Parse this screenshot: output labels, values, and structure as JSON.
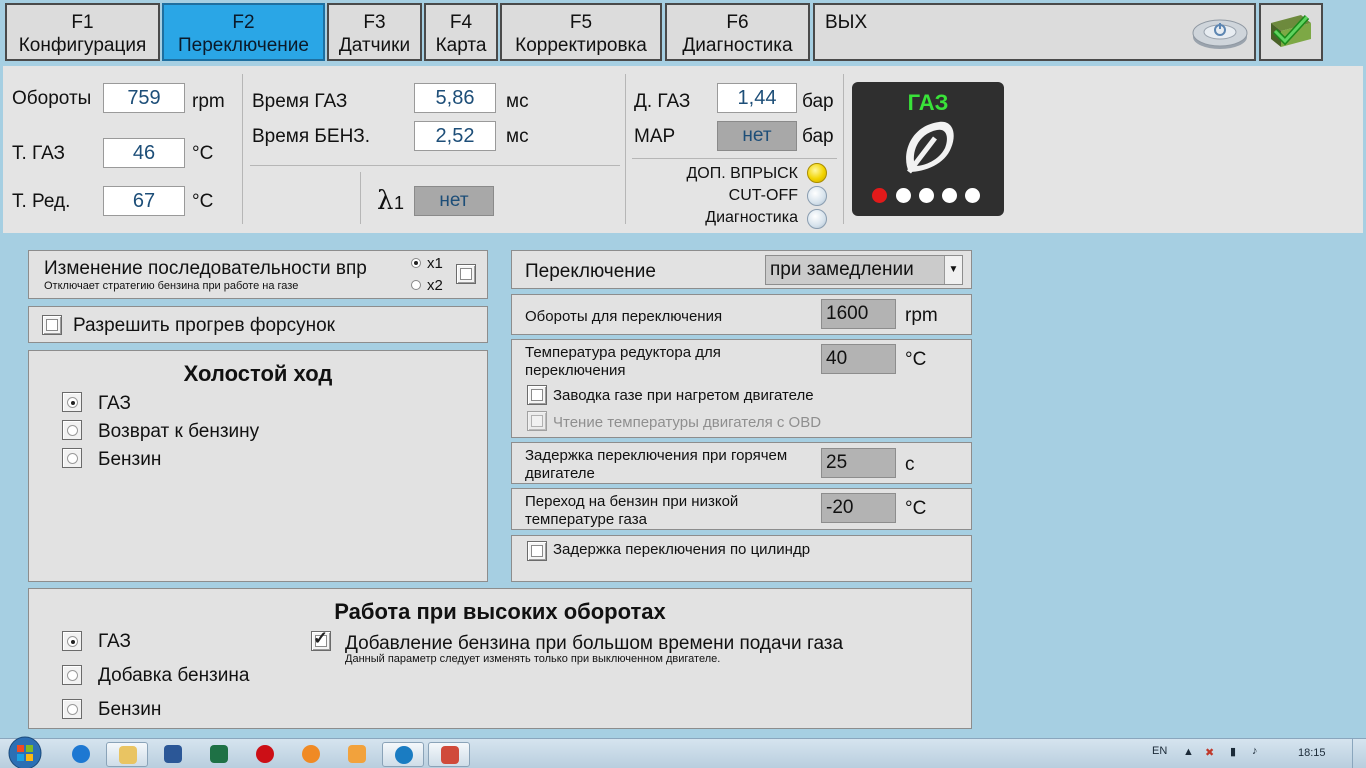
{
  "tabs": [
    {
      "key": "F1",
      "label": "Конфигурация"
    },
    {
      "key": "F2",
      "label": "Переключение"
    },
    {
      "key": "F3",
      "label": "Датчики"
    },
    {
      "key": "F4",
      "label": "Карта"
    },
    {
      "key": "F5",
      "label": "Корректировка"
    },
    {
      "key": "F6",
      "label": "Диагностика"
    }
  ],
  "exit_label": "ВЫХ",
  "active_tab": "F2",
  "status": {
    "rpm": {
      "label": "Обороты",
      "value": "759",
      "unit": "rpm"
    },
    "t_gas": {
      "label": "Т. ГАЗ",
      "value": "46",
      "unit": "°C"
    },
    "t_red": {
      "label": "Т. Ред.",
      "value": "67",
      "unit": "°C"
    },
    "time_gas": {
      "label": "Время ГАЗ",
      "value": "5,86",
      "unit": "мс"
    },
    "time_benz": {
      "label": "Время БЕНЗ.",
      "value": "2,52",
      "unit": "мс"
    },
    "lambda": {
      "symbol": "λ",
      "index": "1",
      "value": "нет"
    },
    "p_gas": {
      "label": "Д. ГАЗ",
      "value": "1,44",
      "unit": "бар"
    },
    "map": {
      "label": "MAP",
      "value": "нет",
      "unit": "бар"
    },
    "indicators": [
      {
        "label": "ДОП. ВПРЫСК",
        "on": true
      },
      {
        "label": "CUT-OFF",
        "on": false
      },
      {
        "label": "Диагностика",
        "on": false
      }
    ],
    "fuel_badge": {
      "label": "ГАЗ",
      "color": "#39e239"
    }
  },
  "sequence": {
    "title": "Изменение последовательности впр",
    "note": "Отключает стратегию бензина при работе на газе",
    "x1": "x1",
    "x2": "x2",
    "selected": "x1",
    "checked": false
  },
  "warmup": {
    "label": "Разрешить прогрев форсунок",
    "checked": false
  },
  "idle": {
    "title": "Холостой ход",
    "options": [
      "ГАЗ",
      "Возврат к бензину",
      "Бензин"
    ],
    "selected": 0
  },
  "switching": {
    "label": "Переключение",
    "mode": "при замедлении",
    "rpm": {
      "label": "Обороты для переключения",
      "value": "1600",
      "unit": "rpm"
    },
    "temp": {
      "label_line1": "Температура редуктора для",
      "label_line2": "переключения",
      "value": "40",
      "unit": "°C"
    },
    "start_hot": {
      "label": "Заводка газе при нагретом двигателе",
      "checked": false
    },
    "obd_temp": {
      "label": "Чтение температуры двигателя с OBD",
      "checked": false,
      "disabled": true
    },
    "hot_delay": {
      "label_line1": "Задержка переключения при горячем",
      "label_line2": "двигателе",
      "value": "25",
      "unit": "с"
    },
    "low_temp": {
      "label_line1": "Переход на бензин при низкой",
      "label_line2": "температуре газа",
      "value": "-20",
      "unit": "°C"
    },
    "cyl_delay": {
      "label": "Задержка переключения по цилиндр",
      "checked": false
    }
  },
  "high_rpm": {
    "title": "Работа при высоких оборотах",
    "options": [
      "ГАЗ",
      "Добавка бензина",
      "Бензин"
    ],
    "selected": 0,
    "add_petrol": {
      "label": "Добавление бензина при большом времени подачи газа",
      "note": "Данный параметр следует изменять только при выключенном двигателе.",
      "checked": true
    }
  },
  "taskbar": {
    "lang": "EN",
    "time": "18:15"
  }
}
